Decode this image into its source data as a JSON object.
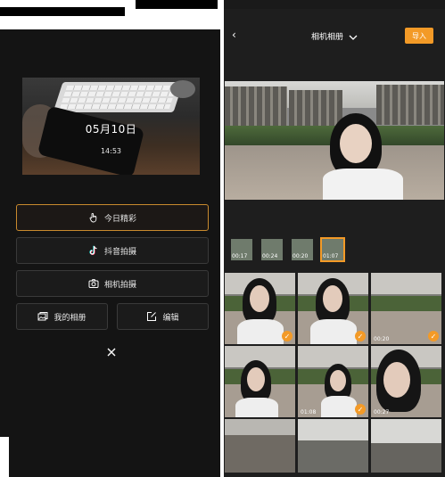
{
  "left": {
    "preview": {
      "date": "05月10日",
      "time": "14:53"
    },
    "buttons": {
      "today": "今日精彩",
      "douyin": "抖音拍摄",
      "camera": "相机拍摄",
      "album": "我的相册",
      "edit": "编辑"
    }
  },
  "right": {
    "header": {
      "back": "‹",
      "title": "相机相册",
      "import": "导入"
    },
    "thumbnails": [
      {
        "duration": "00:17"
      },
      {
        "duration": "00:24"
      },
      {
        "duration": "00:20"
      },
      {
        "duration": "01:07",
        "selected": true
      }
    ],
    "grid": [
      {
        "duration": "",
        "checked": true
      },
      {
        "duration": "",
        "checked": true
      },
      {
        "duration": "00:20",
        "checked": true
      },
      {
        "duration": "",
        "checked": false
      },
      {
        "duration": "01:08",
        "checked": true
      },
      {
        "duration": "00:27",
        "checked": false
      },
      {
        "duration": "",
        "checked": false
      },
      {
        "duration": "",
        "checked": false
      },
      {
        "duration": "",
        "checked": false
      }
    ]
  },
  "colors": {
    "accent": "#f39a27",
    "background": "#141414"
  }
}
